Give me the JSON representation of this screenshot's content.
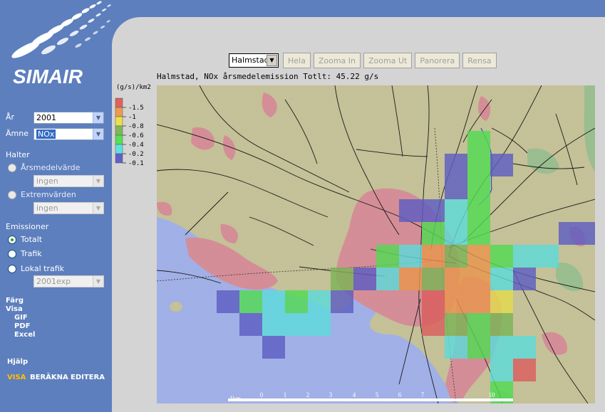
{
  "app": {
    "name": "SIMAIR"
  },
  "sidebar": {
    "year_label": "År",
    "year_value": "2001",
    "substance_label": "Ämne",
    "substance_value": "NOx",
    "halter_heading": "Halter",
    "arsmedel_label": "Årsmedelvärde",
    "arsmedel_value": "ingen",
    "extrem_label": "Extremvärden",
    "extrem_value": "ingen",
    "emissioner_heading": "Emissioner",
    "totalt_label": "Totalt",
    "trafik_label": "Trafik",
    "lokal_label": "Lokal trafik",
    "lokal_value": "2001exp",
    "farg": "Färg",
    "visa": "Visa",
    "gif": "GIF",
    "pdf": "PDF",
    "excel": "Excel",
    "hjalp": "Hjälp",
    "nav_visa": "VISA",
    "nav_berakna": "BERÄKNA",
    "nav_editera": "EDITERA"
  },
  "toolbar": {
    "city": "Halmstad",
    "hela": "Hela",
    "zoom_in": "Zooma In",
    "zoom_out": "Zooma Ut",
    "panorera": "Panorera",
    "rensa": "Rensa"
  },
  "map": {
    "title": "Halmstad, NOx årsmedelemission Totlt: 45.22 g/s",
    "scale_unit": "1km",
    "scale_ticks": [
      "0",
      "1",
      "2",
      "3",
      "4",
      "5",
      "6",
      "7",
      "10"
    ]
  },
  "legend": {
    "unit": "(g/s)/km2",
    "entries": [
      {
        "label": "1.5",
        "color": "#e06060"
      },
      {
        "label": "1",
        "color": "#ee9a50"
      },
      {
        "label": "0.8",
        "color": "#e8e050"
      },
      {
        "label": "0.6",
        "color": "#7fb858"
      },
      {
        "label": "0.4",
        "color": "#55e055"
      },
      {
        "label": "0.2",
        "color": "#60e0e0"
      },
      {
        "label": "0.1",
        "color": "#6060c8"
      }
    ]
  },
  "colors": {
    "sidebar": "#5d7fbe",
    "content": "#d4d4d4",
    "land": "#c9c59b",
    "water": "#a4b4ec",
    "urban": "#d9919a",
    "green": "#9ec294",
    "accent": "#ffc000"
  }
}
